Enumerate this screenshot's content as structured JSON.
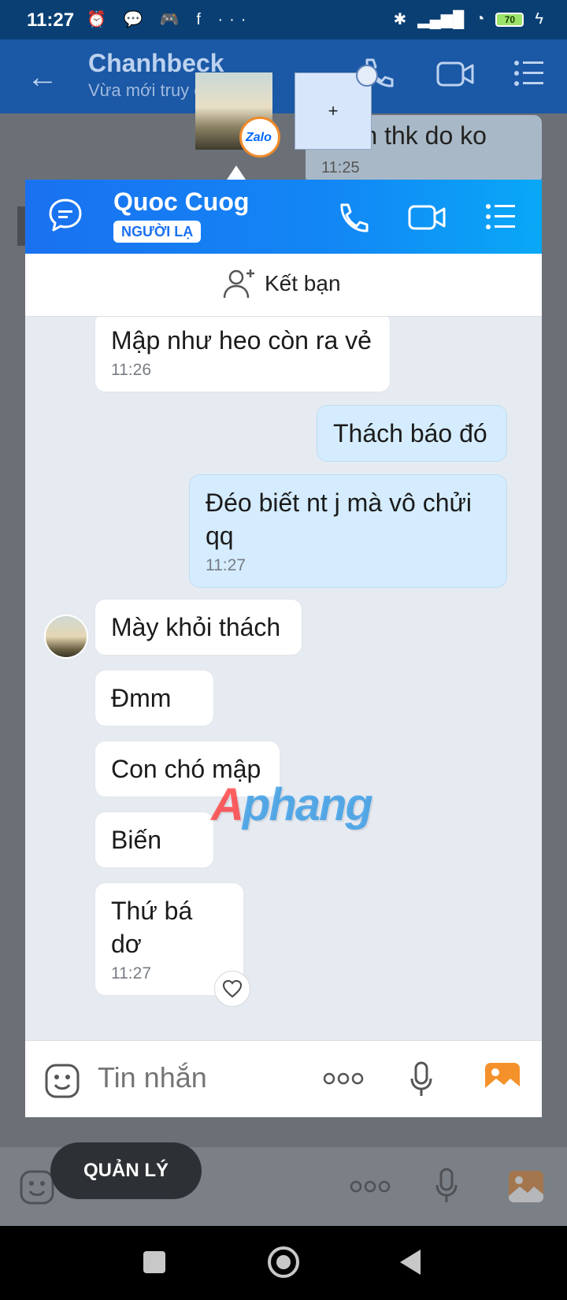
{
  "status_bar": {
    "time": "11:27",
    "battery": "70",
    "left_icons": "⏰ 💬 🎮 f ···"
  },
  "background_chat": {
    "name": "Chanhbeck",
    "status": "Vừa mới truy cập",
    "visible_message_text": "quen thk do ko",
    "visible_message_time": "11:25"
  },
  "drag": {
    "badge_label": "Zalo",
    "add_label": "+"
  },
  "bubble": {
    "name": "Quoc Cuog",
    "badge": "NGƯỜI LẠ",
    "add_friend_label": "Kết bạn",
    "messages": [
      {
        "dir": "in",
        "text": "Mập như heo còn ra vẻ",
        "time": "11:26"
      },
      {
        "dir": "out",
        "text": "Thách báo đó",
        "time": ""
      },
      {
        "dir": "out",
        "text": "Đéo biết nt j mà vô chửi qq",
        "time": "11:27"
      },
      {
        "dir": "in",
        "text": "Mày khỏi thách",
        "time": ""
      },
      {
        "dir": "in",
        "text": "Đmm",
        "time": ""
      },
      {
        "dir": "in",
        "text": "Con chó mập",
        "time": ""
      },
      {
        "dir": "in",
        "text": "Biến",
        "time": ""
      },
      {
        "dir": "in",
        "text": "Thứ bá dơ",
        "time": "11:27"
      }
    ],
    "input_placeholder": "Tin nhắn",
    "watermark_a": "A",
    "watermark_b": "phang"
  },
  "manage_button": "QUẢN LÝ",
  "colors": {
    "header_blue": "#1a71f0",
    "outgoing_bubble": "#d4ecfd",
    "image_icon": "#f5912b"
  }
}
